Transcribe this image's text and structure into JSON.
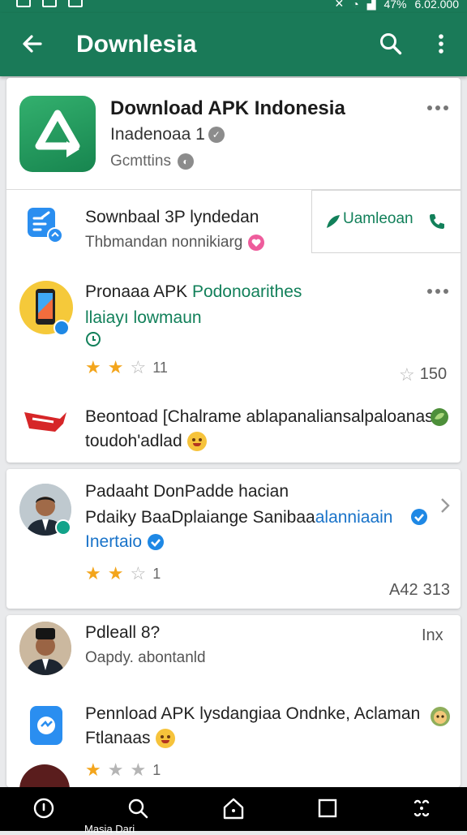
{
  "status_bar": {
    "battery": "47%",
    "clock": "6.02.000"
  },
  "app_bar": {
    "title": "Downlesia"
  },
  "hero": {
    "title": "Download APK Indonesia",
    "subtitle": "Inadenoaa 1",
    "meta": "Gcmttins"
  },
  "rows": [
    {
      "title": "Sownbaal 3P lyndedan",
      "subtitle": "Thbmandan nonnikiarg",
      "action_label": "Uamleoan"
    },
    {
      "title": "Pronaaa APK",
      "title_accent": "Podonoarithes",
      "subtitle": "llaiayı lowmaun",
      "rating_count": "11",
      "star_count": "150"
    },
    {
      "title": "Beontoad [Chalrame ablapanaliansalpaloanas",
      "subtitle": "toudoh'adlad"
    }
  ],
  "card2": {
    "title": "Padaaht DonPadde hacian",
    "subtitle": "Pdaiky BaaDplaiange Sanibaa",
    "subtitle_accent": "alanniaain",
    "tag": "Inertaio",
    "rating_count": "1",
    "right_value": "313",
    "right_prefix": "A42"
  },
  "card3": {
    "title": "Pdleall 8?",
    "subtitle": "Oapdy. abontanld",
    "corner": "Inx",
    "row_title": "Pennload APK lysdangiaa Ondnke, Aclaman",
    "row_subtitle": "Ftlanaas",
    "rating_count": "1"
  },
  "nav": {
    "label": "Masia Dari"
  },
  "colors": {
    "primary": "#1a7a58",
    "accent_green": "#12805a",
    "accent_blue": "#1973c9",
    "star": "#f3a51c"
  },
  "icons": [
    "back-arrow-icon",
    "search-icon",
    "more-vert-icon",
    "app-logo-icon",
    "phone-icon",
    "send-icon",
    "verified-icon",
    "star-icon",
    "heart-icon",
    "home-icon",
    "square-icon"
  ]
}
